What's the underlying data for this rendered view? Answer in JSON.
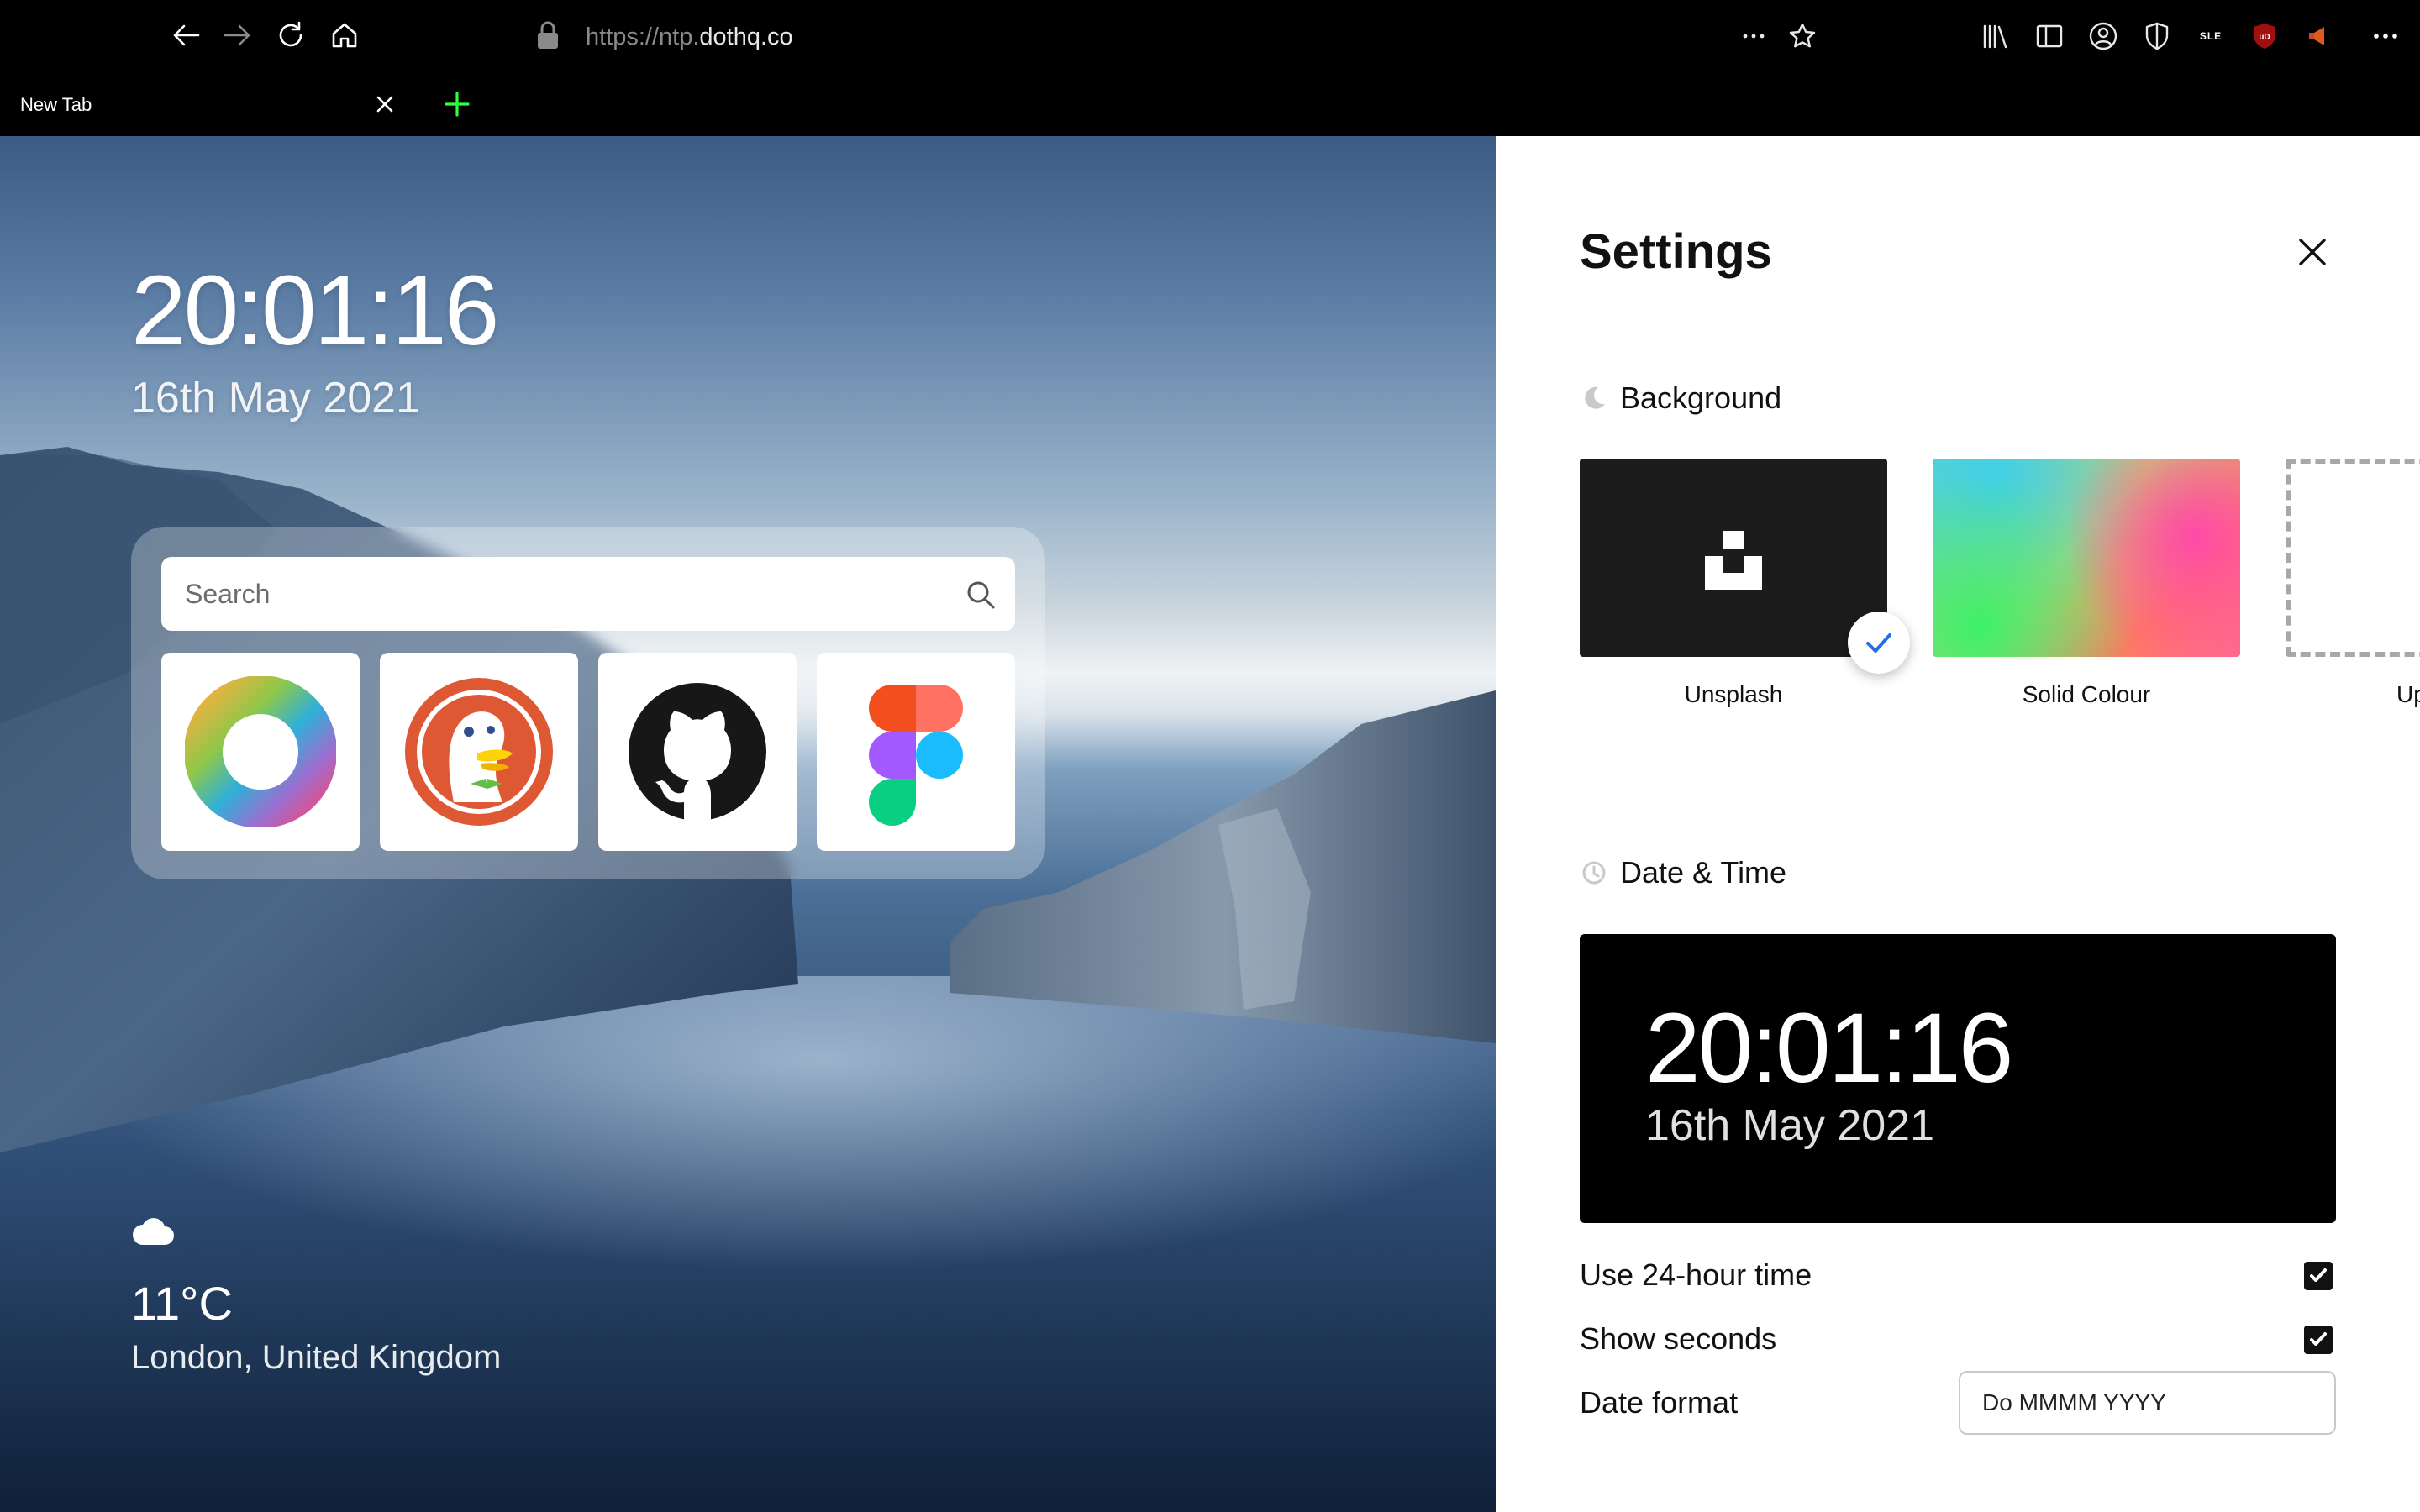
{
  "browser": {
    "url_prefix": "https://ntp.",
    "url_domain": "dothq.co",
    "tab_title": "New Tab",
    "toolbar_text_badge": "SLE",
    "accent_new_tab": "#2cff3c"
  },
  "ntp": {
    "time": "20:01:16",
    "date": "16th May 2021",
    "search_placeholder": "Search",
    "shortcuts": [
      {
        "name": "colour-ring"
      },
      {
        "name": "duckduckgo"
      },
      {
        "name": "github"
      },
      {
        "name": "figma"
      }
    ],
    "weather": {
      "icon": "cloud-icon",
      "temperature": "11°C",
      "location": "London, United Kingdom"
    }
  },
  "settings": {
    "title": "Settings",
    "background_section": "Background",
    "background_options": [
      "Unsplash",
      "Solid Colour",
      "Upload"
    ],
    "selected_background": "Unsplash",
    "datetime_section": "Date & Time",
    "preview_time": "20:01:16",
    "preview_date": "16th May 2021",
    "use_24h_label": "Use 24-hour time",
    "use_24h_checked": true,
    "show_seconds_label": "Show seconds",
    "show_seconds_checked": true,
    "date_format_label": "Date format",
    "date_format_value": "Do MMMM YYYY",
    "accent_check": "#1f6fe8"
  }
}
